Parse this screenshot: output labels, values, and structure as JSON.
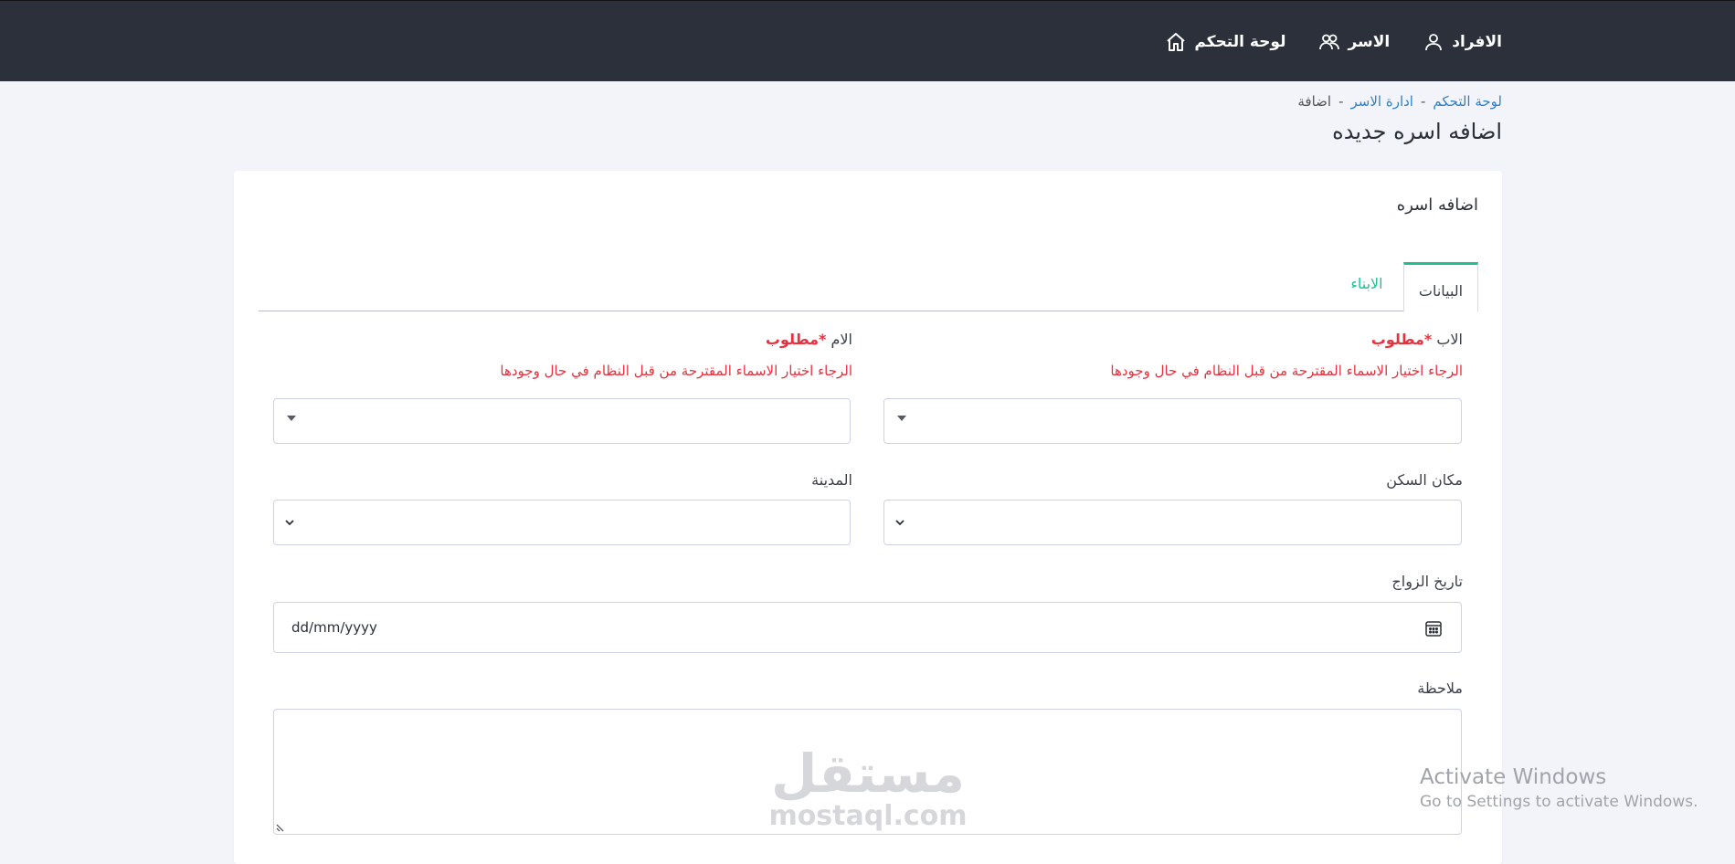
{
  "nav": {
    "items": [
      {
        "label": "لوحة التحكم",
        "icon": "home-icon"
      },
      {
        "label": "الاسر",
        "icon": "users-icon"
      },
      {
        "label": "الافراد",
        "icon": "user-icon"
      }
    ]
  },
  "breadcrumb": {
    "home": "لوحة التحكم",
    "sep1": "-",
    "families": "ادارة الاسر",
    "sep2": "-",
    "current": "اضافة"
  },
  "page": {
    "title": "اضافه اسره جديده"
  },
  "card": {
    "title": "اضافه اسره",
    "tabs": [
      {
        "label": "البيانات",
        "active": true
      },
      {
        "label": "الابناء",
        "active": false
      }
    ]
  },
  "form": {
    "father": {
      "label": "الاب",
      "required": "*مطلوب",
      "hint": "الرجاء اختيار الاسماء المقترحة من قبل النظام في حال وجودها",
      "value": ""
    },
    "mother": {
      "label": "الام",
      "required": "*مطلوب",
      "hint": "الرجاء اختيار الاسماء المقترحة من قبل النظام في حال وجودها",
      "value": ""
    },
    "residence": {
      "label": "مكان السكن",
      "value": ""
    },
    "city": {
      "label": "المدينة",
      "value": ""
    },
    "marriage_date": {
      "label": "تاريخ الزواج",
      "placeholder": "dd/mm/yyyy"
    },
    "note": {
      "label": "ملاحظة",
      "value": ""
    }
  },
  "watermark": {
    "arabic": "مستقل",
    "latin": "mostaql.com"
  },
  "os_overlay": {
    "line1": "Activate Windows",
    "line2": "Go to Settings to activate Windows."
  },
  "colors": {
    "topbar": "#2b303b",
    "accent": "#1fbf8f",
    "link": "#2f80c8",
    "required": "#e8313e",
    "background": "#f3f4f9"
  }
}
